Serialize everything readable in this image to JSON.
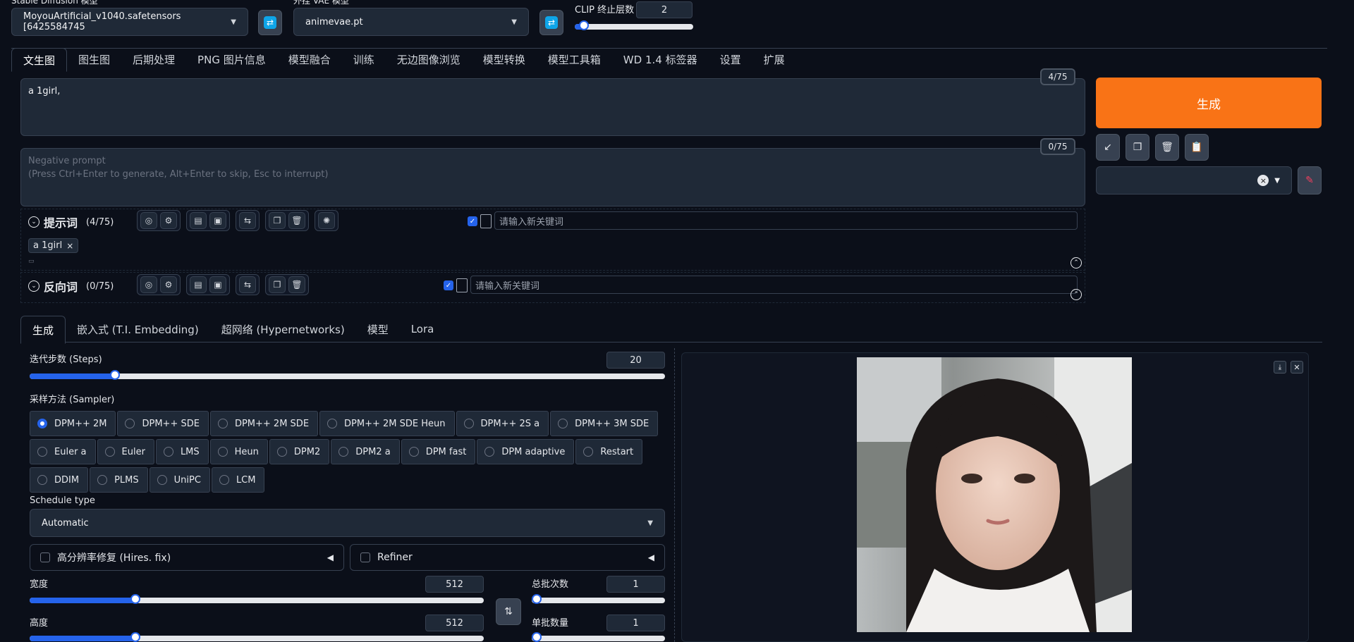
{
  "top": {
    "sd_model_label": "Stable Diffusion 模型",
    "sd_model_value": "MoyouArtificial_v1040.safetensors [6425584745",
    "vae_label": "外挂 VAE 模型",
    "vae_value": "animevae.pt",
    "clip_label": "CLIP 终止层数",
    "clip_value": "2",
    "clip_fraction": 0.08
  },
  "tabs": [
    "文生图",
    "图生图",
    "后期处理",
    "PNG 图片信息",
    "模型融合",
    "训练",
    "无边图像浏览",
    "模型转换",
    "模型工具箱",
    "WD 1.4 标签器",
    "设置",
    "扩展"
  ],
  "prompt": {
    "text": "a 1girl,",
    "counter": "4/75",
    "neg_placeholder": "Negative prompt\n(Press Ctrl+Enter to generate, Alt+Enter to skip, Esc to interrupt)",
    "neg_line1": "Negative prompt",
    "neg_line2": "(Press Ctrl+Enter to generate, Alt+Enter to skip, Esc to interrupt)",
    "neg_counter": "0/75"
  },
  "generate_label": "生成",
  "tool_icons": [
    "↙",
    "❐",
    "🗑",
    "📋"
  ],
  "style_clear": "×",
  "pos_helper": {
    "title": "提示词",
    "count": "(4/75)",
    "kw_placeholder": "请输入新关键词",
    "tag": "a 1girl",
    "tag_close": "×"
  },
  "neg_helper": {
    "title": "反向词",
    "count": "(0/75)",
    "kw_placeholder": "请输入新关键词"
  },
  "subtabs": [
    "生成",
    "嵌入式 (T.I. Embedding)",
    "超网络 (Hypernetworks)",
    "模型",
    "Lora"
  ],
  "steps": {
    "label": "迭代步数 (Steps)",
    "value": "20",
    "fraction": 0.134
  },
  "sampler": {
    "label": "采样方法 (Sampler)",
    "options": [
      "DPM++ 2M",
      "DPM++ SDE",
      "DPM++ 2M SDE",
      "DPM++ 2M SDE Heun",
      "DPM++ 2S a",
      "DPM++ 3M SDE",
      "Euler a",
      "Euler",
      "LMS",
      "Heun",
      "DPM2",
      "DPM2 a",
      "DPM fast",
      "DPM adaptive",
      "Restart",
      "DDIM",
      "PLMS",
      "UniPC",
      "LCM"
    ],
    "selected": "DPM++ 2M"
  },
  "schedule": {
    "label": "Schedule type",
    "value": "Automatic"
  },
  "hires_label": "高分辨率修复 (Hires. fix)",
  "refiner_label": "Refiner",
  "width": {
    "label": "宽度",
    "value": "512",
    "fraction": 0.233
  },
  "height": {
    "label": "高度",
    "value": "512",
    "fraction": 0.233
  },
  "batch_count": {
    "label": "总批次数",
    "value": "1",
    "fraction": 0.0
  },
  "batch_size": {
    "label": "单批数量",
    "value": "1",
    "fraction": 0.0
  },
  "colors": {
    "accent": "#2563eb",
    "generate": "#f97316",
    "bg": "#0b0f19"
  }
}
